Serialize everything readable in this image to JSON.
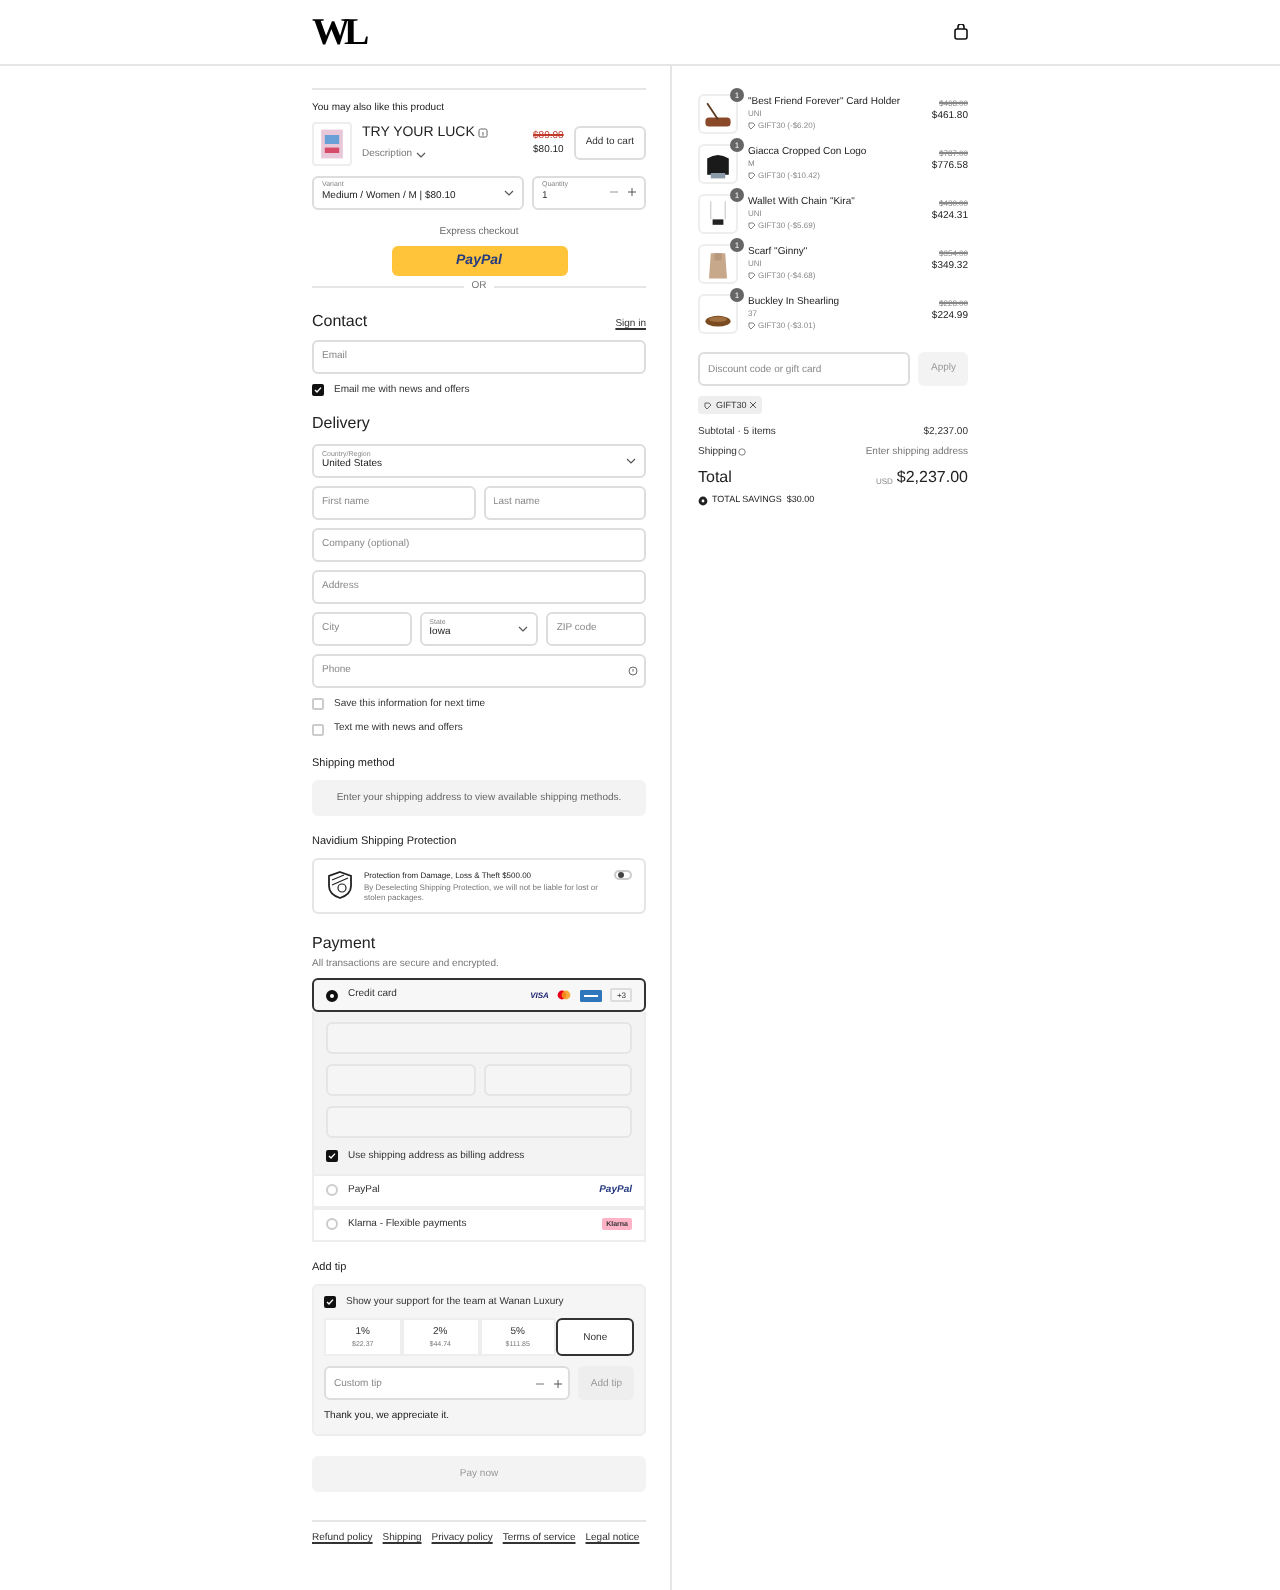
{
  "brand": "WL",
  "upsell": {
    "heading": "You may also like this product",
    "name": "TRY YOUR LUCK",
    "description": "Description",
    "old_price": "$89.00",
    "price": "$80.10",
    "add_button": "Add to cart",
    "variant": {
      "label": "Variant",
      "value": "Medium / Women / M | $80.10"
    },
    "quantity": {
      "label": "Quantity",
      "value": "1"
    }
  },
  "express": {
    "title": "Express checkout",
    "paypal": "PayPal",
    "or": "OR"
  },
  "contact": {
    "title": "Contact",
    "sign_in": "Sign in",
    "email": {
      "placeholder": "Email"
    },
    "news": {
      "label": "Email me with news and offers",
      "checked": true
    }
  },
  "delivery": {
    "title": "Delivery",
    "country": {
      "label": "Country/Region",
      "value": "United States"
    },
    "first_name": {
      "placeholder": "First name"
    },
    "last_name": {
      "placeholder": "Last name"
    },
    "company": {
      "placeholder": "Company (optional)"
    },
    "address": {
      "placeholder": "Address"
    },
    "city": {
      "placeholder": "City"
    },
    "state": {
      "label": "State",
      "value": "Iowa"
    },
    "zip": {
      "placeholder": "ZIP code"
    },
    "phone": {
      "placeholder": "Phone"
    },
    "options": [
      {
        "label": "Save this information for next time",
        "checked": false
      },
      {
        "label": "Text me with news and offers",
        "checked": false
      }
    ]
  },
  "shipping_method": {
    "title": "Shipping method",
    "notice": "Enter your shipping address to view available shipping methods."
  },
  "protection": {
    "title": "Navidium Shipping Protection",
    "heading": "Protection from Damage, Loss & Theft $500.00",
    "text": "By Deselecting Shipping Protection, we will not be liable for lost or stolen packages.",
    "on": false
  },
  "payment": {
    "title": "Payment",
    "subtitle": "All transactions are secure and encrypted.",
    "methods": [
      {
        "kind": "card",
        "label": "Credit card",
        "selected": true,
        "visa": "VISA",
        "more": "+3"
      },
      {
        "kind": "paypal",
        "label": "PayPal",
        "selected": false,
        "logo": "PayPal"
      },
      {
        "kind": "klarna",
        "label": "Klarna - Flexible payments",
        "selected": false,
        "logo": "Klarna"
      }
    ],
    "billing": {
      "label": "Use shipping address as billing address",
      "checked": true
    }
  },
  "tip": {
    "title": "Add tip",
    "support": {
      "label": "Show your support for the team at Wanan Luxury",
      "checked": true
    },
    "options": [
      {
        "percent": "1%",
        "amount": "$22.37",
        "selected": false
      },
      {
        "percent": "2%",
        "amount": "$44.74",
        "selected": false
      },
      {
        "percent": "5%",
        "amount": "$111.85",
        "selected": false
      },
      {
        "percent": "None",
        "selected": true
      }
    ],
    "custom": {
      "placeholder": "Custom tip"
    },
    "add_button": "Add tip",
    "thanks": "Thank you, we appreciate it."
  },
  "pay_button": "Pay now",
  "footer_links": [
    "Refund policy",
    "Shipping",
    "Privacy policy",
    "Terms of service",
    "Legal notice"
  ],
  "cart": {
    "items": [
      {
        "name": "\"Best Friend Forever\" Card Holder",
        "variant": "UNI",
        "quantity": "1",
        "discount": "GIFT30 (-$6.20)",
        "old_price": "$468.00",
        "price": "$461.80"
      },
      {
        "name": "Giacca Cropped Con Logo",
        "variant": "M",
        "quantity": "1",
        "discount": "GIFT30 (-$10.42)",
        "old_price": "$787.00",
        "price": "$776.58"
      },
      {
        "name": "Wallet With Chain \"Kira\"",
        "variant": "UNI",
        "quantity": "1",
        "discount": "GIFT30 (-$5.69)",
        "old_price": "$430.00",
        "price": "$424.31"
      },
      {
        "name": "Scarf \"Ginny\"",
        "variant": "UNI",
        "quantity": "1",
        "discount": "GIFT30 (-$4.68)",
        "old_price": "$354.00",
        "price": "$349.32"
      },
      {
        "name": "Buckley In Shearling",
        "variant": "37",
        "quantity": "1",
        "discount": "GIFT30 (-$3.01)",
        "old_price": "$228.00",
        "price": "$224.99"
      }
    ],
    "discount_field": {
      "placeholder": "Discount code or gift card"
    },
    "apply_button": "Apply",
    "code": "GIFT30",
    "subtotal": {
      "label": "Subtotal · 5 items",
      "value": "$2,237.00"
    },
    "shipping": {
      "label": "Shipping",
      "value": "Enter shipping address"
    },
    "total": {
      "label": "Total",
      "currency": "USD",
      "value": "$2,237.00"
    },
    "savings": "TOTAL SAVINGS  $30.00"
  }
}
